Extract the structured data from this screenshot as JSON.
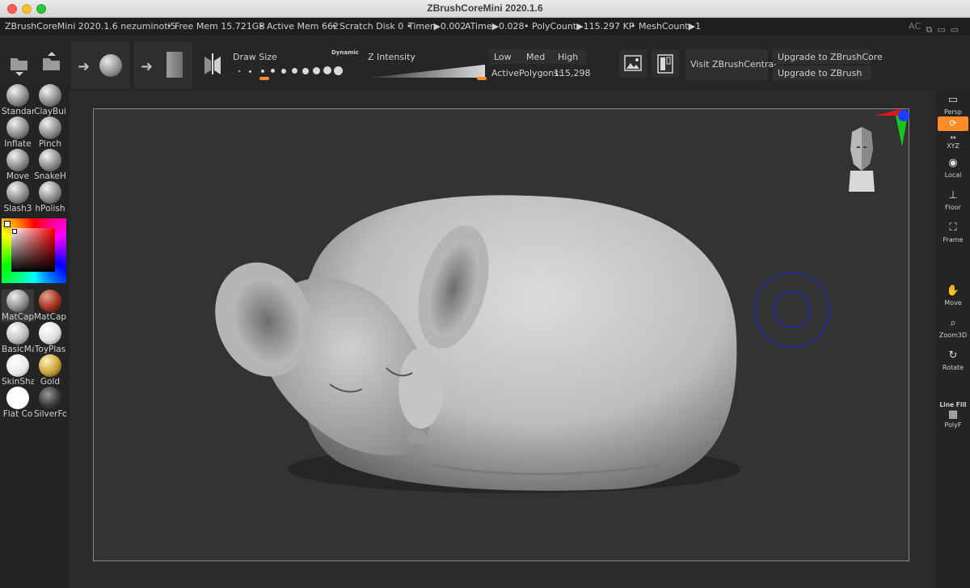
{
  "window": {
    "title": "ZBrushCoreMini 2020.1.6"
  },
  "status": {
    "app": "ZBrushCoreMini 2020.1.6 nezuminoti5",
    "free_mem": "• Free Mem 15.721GB",
    "active_mem": "• Active Mem 662",
    "scratch": "• Scratch Disk 0 •",
    "timer": "Timer▶0.002",
    "atime": "ATime▶0.028",
    "polycount": "• PolyCount▶115.297 KP",
    "meshcount": "• MeshCount▶1",
    "ac": "AC"
  },
  "toolbar": {
    "draw_size_label": "Draw Size",
    "dynamic_label": "Dynamic",
    "z_intensity_label": "Z Intensity",
    "low_label": "Low",
    "med_label": "Med",
    "high_label": "High",
    "active_polygons_label": "ActivePolygons:",
    "active_polygons_value": "115,298",
    "visit_label": "Visit ZBrushCentral",
    "upgrade_core_label": "Upgrade to ZBrushCore",
    "upgrade_zbrush_label": "Upgrade to ZBrush",
    "draw_size_selected_index": 2,
    "z_intensity_level": 1.0
  },
  "brushes": [
    {
      "label": "Standar",
      "icon": "standard-brush-icon"
    },
    {
      "label": "ClayBui",
      "icon": "claybuildup-brush-icon"
    },
    {
      "label": "Inflate",
      "icon": "inflate-brush-icon"
    },
    {
      "label": "Pinch",
      "icon": "pinch-brush-icon"
    },
    {
      "label": "Move",
      "icon": "move-brush-icon"
    },
    {
      "label": "SnakeH",
      "icon": "snakehook-brush-icon"
    },
    {
      "label": "Slash3",
      "icon": "slash3-brush-icon"
    },
    {
      "label": "hPolish",
      "icon": "hpolish-brush-icon"
    }
  ],
  "materials": [
    {
      "label": "MatCap",
      "color": "#8c8c8c"
    },
    {
      "label": "MatCap",
      "color": "#a0321e"
    },
    {
      "label": "BasicMa",
      "color": "#bdbdbd"
    },
    {
      "label": "ToyPlas",
      "color": "#e0e0e0"
    },
    {
      "label": "SkinSha",
      "color": "#e8e8e8"
    },
    {
      "label": "Gold",
      "color": "#c9a23a"
    },
    {
      "label": "Flat Co",
      "color": "#ffffff"
    },
    {
      "label": "SilverFo",
      "color": "#3a3a3a"
    }
  ],
  "right_shelf": [
    {
      "label": "Persp",
      "icon": "persp-icon"
    },
    {
      "label": "",
      "icon": "refresh-icon"
    },
    {
      "label": "XYZ",
      "icon": "xyz-icon"
    },
    {
      "label": "Local",
      "icon": "local-icon"
    },
    {
      "label": "Floor",
      "icon": "floor-icon"
    },
    {
      "label": "Frame",
      "icon": "frame-icon"
    },
    {
      "label": "Move",
      "icon": "move-hand-icon"
    },
    {
      "label": "Zoom3D",
      "icon": "zoom-icon"
    },
    {
      "label": "Rotate",
      "icon": "rotate-icon"
    },
    {
      "label": "Line Fill",
      "icon": "linefill-icon"
    },
    {
      "label": "PolyF",
      "icon": "polyf-icon"
    }
  ],
  "colors": {
    "accent_orange": "#ff8c28",
    "gizmo_red": "#e01818",
    "gizmo_green": "#18c818",
    "gizmo_blue": "#1e3cff",
    "cursor_blue": "#1e28b4"
  }
}
